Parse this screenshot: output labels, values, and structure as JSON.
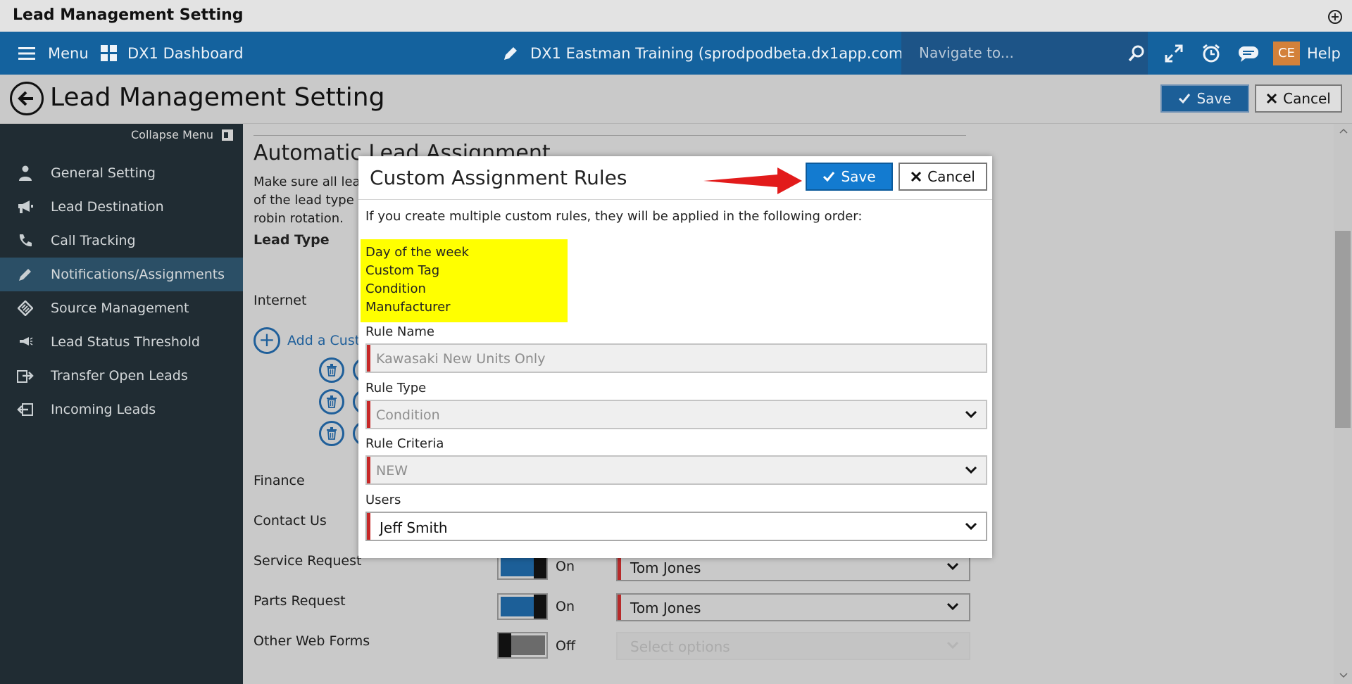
{
  "window": {
    "title": "Lead Management Setting"
  },
  "topnav": {
    "menu_label": "Menu",
    "dashboard_label": "DX1 Dashboard",
    "site_label": "DX1 Eastman Training (sprodpodbeta.dx1app.com)",
    "search_placeholder": "Navigate to...",
    "avatar_initials": "CE",
    "help_label": "Help"
  },
  "page": {
    "title": "Lead Management Setting",
    "save_label": "Save",
    "cancel_label": "Cancel"
  },
  "sidebar": {
    "collapse_label": "Collapse Menu",
    "items": [
      {
        "label": "General Setting",
        "icon": "user-tie-icon"
      },
      {
        "label": "Lead Destination",
        "icon": "megaphone-icon"
      },
      {
        "label": "Call Tracking",
        "icon": "phone-icon"
      },
      {
        "label": "Notifications/Assignments",
        "icon": "pencil-icon",
        "active": true
      },
      {
        "label": "Source Management",
        "icon": "tag-icon"
      },
      {
        "label": "Lead Status Threshold",
        "icon": "bullhorn-icon"
      },
      {
        "label": "Transfer Open Leads",
        "icon": "transfer-icon"
      },
      {
        "label": "Incoming Leads",
        "icon": "incoming-icon"
      }
    ]
  },
  "main": {
    "section_title": "Automatic Lead Assignment",
    "desc_line1": "Make sure all lead",
    "desc_line2": "of the lead type a",
    "desc_line3": "robin rotation.",
    "lead_type_label": "Lead Type",
    "rows": {
      "internet": "Internet",
      "add_custom": "Add a Custo",
      "finance": "Finance",
      "contact_us": "Contact Us",
      "service_request": "Service Request",
      "parts_request": "Parts Request",
      "other_web_forms": "Other Web Forms"
    },
    "service_toggle": "On",
    "parts_toggle": "On",
    "other_toggle": "Off",
    "service_user": "Tom Jones",
    "parts_user": "Tom Jones",
    "other_placeholder": "Select options"
  },
  "modal": {
    "title": "Custom Assignment Rules",
    "save_label": "Save",
    "cancel_label": "Cancel",
    "info": "If you create multiple custom rules, they will be applied in the following order:",
    "order": [
      "Day of the week",
      "Custom Tag",
      "Condition",
      "Manufacturer"
    ],
    "rule_name_label": "Rule Name",
    "rule_name_value": "Kawasaki New Units Only",
    "rule_type_label": "Rule Type",
    "rule_type_value": "Condition",
    "rule_criteria_label": "Rule Criteria",
    "rule_criteria_value": "NEW",
    "users_label": "Users",
    "users_value": "Jeff Smith"
  },
  "colors": {
    "nav_blue": "#14629e",
    "sidebar_dark": "#202c33",
    "save_blue": "#137bd0",
    "highlight_yellow": "#ffff00",
    "arrow_red": "#e21b1b"
  }
}
